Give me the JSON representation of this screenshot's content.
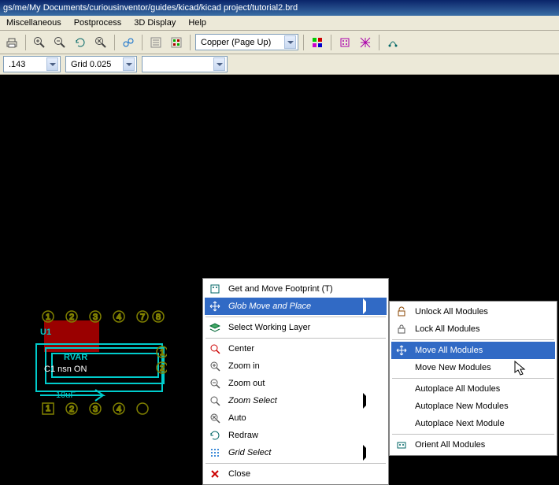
{
  "title_path": "gs/me/My Documents/curiousinventor/guides/kicad/kicad project/tutorial2.brd",
  "menus": {
    "misc": "Miscellaneous",
    "postprocess": "Postprocess",
    "display3d": "3D Display",
    "help": "Help"
  },
  "layer_dd": "Copper (Page Up)",
  "coord_dd": ".143",
  "grid_dd": "Grid 0.025",
  "empty_dd": "",
  "ctx": {
    "get_move": "Get and Move Footprint (T)",
    "glob_move": "Glob Move and Place",
    "select_layer": "Select Working Layer",
    "center": "Center",
    "zoom_in": "Zoom in",
    "zoom_out": "Zoom out",
    "zoom_select": "Zoom Select",
    "auto": "Auto",
    "redraw": "Redraw",
    "grid_select": "Grid Select",
    "close": "Close"
  },
  "sub": {
    "unlock_all": "Unlock All Modules",
    "lock_all": "Lock All Modules",
    "move_all": "Move All Modules",
    "move_new": "Move New Modules",
    "autoplace_all": "Autoplace All Modules",
    "autoplace_new": "Autoplace New Modules",
    "autoplace_next": "Autoplace Next Module",
    "orient_all": "Orient All Modules"
  },
  "pcb_labels": {
    "u1": "U1",
    "rvar": "RVAR",
    "conn": "C1 nsn ON",
    "cap": "10uF"
  }
}
